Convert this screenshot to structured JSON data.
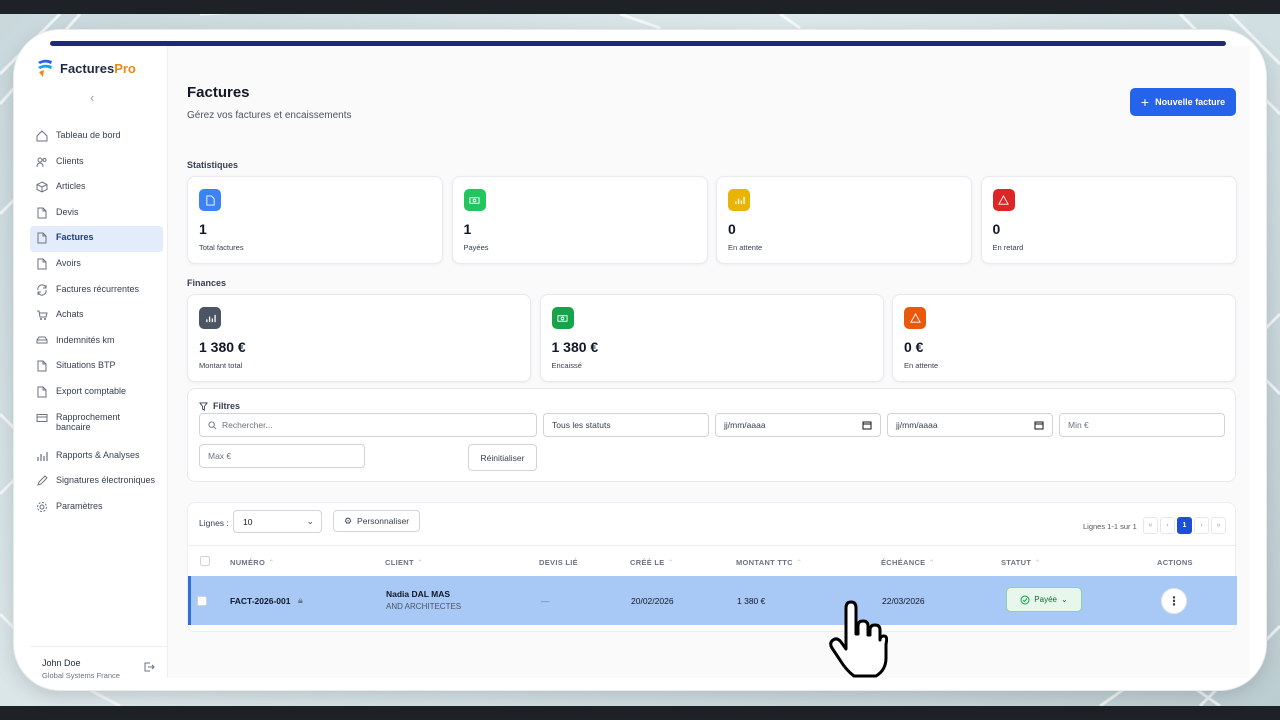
{
  "app": {
    "name_part1": "Factures",
    "name_part2": "Pro"
  },
  "sidebar": {
    "items": [
      {
        "label": "Tableau de bord",
        "icon": "home-icon"
      },
      {
        "label": "Clients",
        "icon": "users-icon"
      },
      {
        "label": "Articles",
        "icon": "box-icon"
      },
      {
        "label": "Devis",
        "icon": "file-icon"
      },
      {
        "label": "Factures",
        "icon": "file-icon",
        "active": true
      },
      {
        "label": "Avoirs",
        "icon": "file-icon"
      },
      {
        "label": "Factures récurrentes",
        "icon": "refresh-icon"
      },
      {
        "label": "Achats",
        "icon": "cart-icon"
      },
      {
        "label": "Indemnités km",
        "icon": "car-icon"
      },
      {
        "label": "Situations BTP",
        "icon": "file-icon"
      },
      {
        "label": "Export comptable",
        "icon": "file-icon"
      },
      {
        "label": "Rapprochement bancaire",
        "icon": "card-icon"
      },
      {
        "label": "Rapports & Analyses",
        "icon": "chart-icon"
      },
      {
        "label": "Signatures électroniques",
        "icon": "pen-icon"
      },
      {
        "label": "Paramètres",
        "icon": "gear-icon"
      }
    ],
    "user_name": "John Doe",
    "user_org": "Global Systems France"
  },
  "header": {
    "title": "Factures",
    "subtitle": "Gérez vos factures et encaissements",
    "new_button": "Nouvelle facture"
  },
  "stats": {
    "label": "Statistiques",
    "cards": [
      {
        "value": "1",
        "label": "Total factures",
        "color": "#3b82f6"
      },
      {
        "value": "1",
        "label": "Payées",
        "color": "#22c55e"
      },
      {
        "value": "0",
        "label": "En attente",
        "color": "#eab308"
      },
      {
        "value": "0",
        "label": "En retard",
        "color": "#dc2626"
      }
    ]
  },
  "finances": {
    "label": "Finances",
    "cards": [
      {
        "value": "1 380 €",
        "label": "Montant total",
        "color": "#4b5563"
      },
      {
        "value": "1 380 €",
        "label": "Encaissé",
        "color": "#16a34a"
      },
      {
        "value": "0 €",
        "label": "En attente",
        "color": "#ea580c"
      }
    ]
  },
  "filters": {
    "title": "Filtres",
    "search_placeholder": "Rechercher...",
    "status": "Tous les statuts",
    "date_from": "jj/mm/aaaa",
    "date_to": "jj/mm/aaaa",
    "min_placeholder": "Min €",
    "max_placeholder": "Max €",
    "reset": "Réinitialiser"
  },
  "table": {
    "rows_label": "Lignes :",
    "rows_value": "10",
    "customize": "Personnaliser",
    "pager_info": "Lignes 1-1 sur 1",
    "pager": [
      "«",
      "‹",
      "1",
      "›",
      "»"
    ],
    "columns": [
      "NUMÉRO",
      "CLIENT",
      "DEVIS LIÉ",
      "CRÉÉ LE",
      "MONTANT TTC",
      "ÉCHÉANCE",
      "STATUT",
      "ACTIONS"
    ],
    "rows": [
      {
        "number": "FACT-2026-001",
        "client_name": "Nadia DAL MAS",
        "client_company": "AND ARCHITECTES",
        "quote": "—",
        "created": "20/02/2026",
        "amount": "1 380 €",
        "due": "22/03/2026",
        "status": "Payée"
      }
    ]
  }
}
